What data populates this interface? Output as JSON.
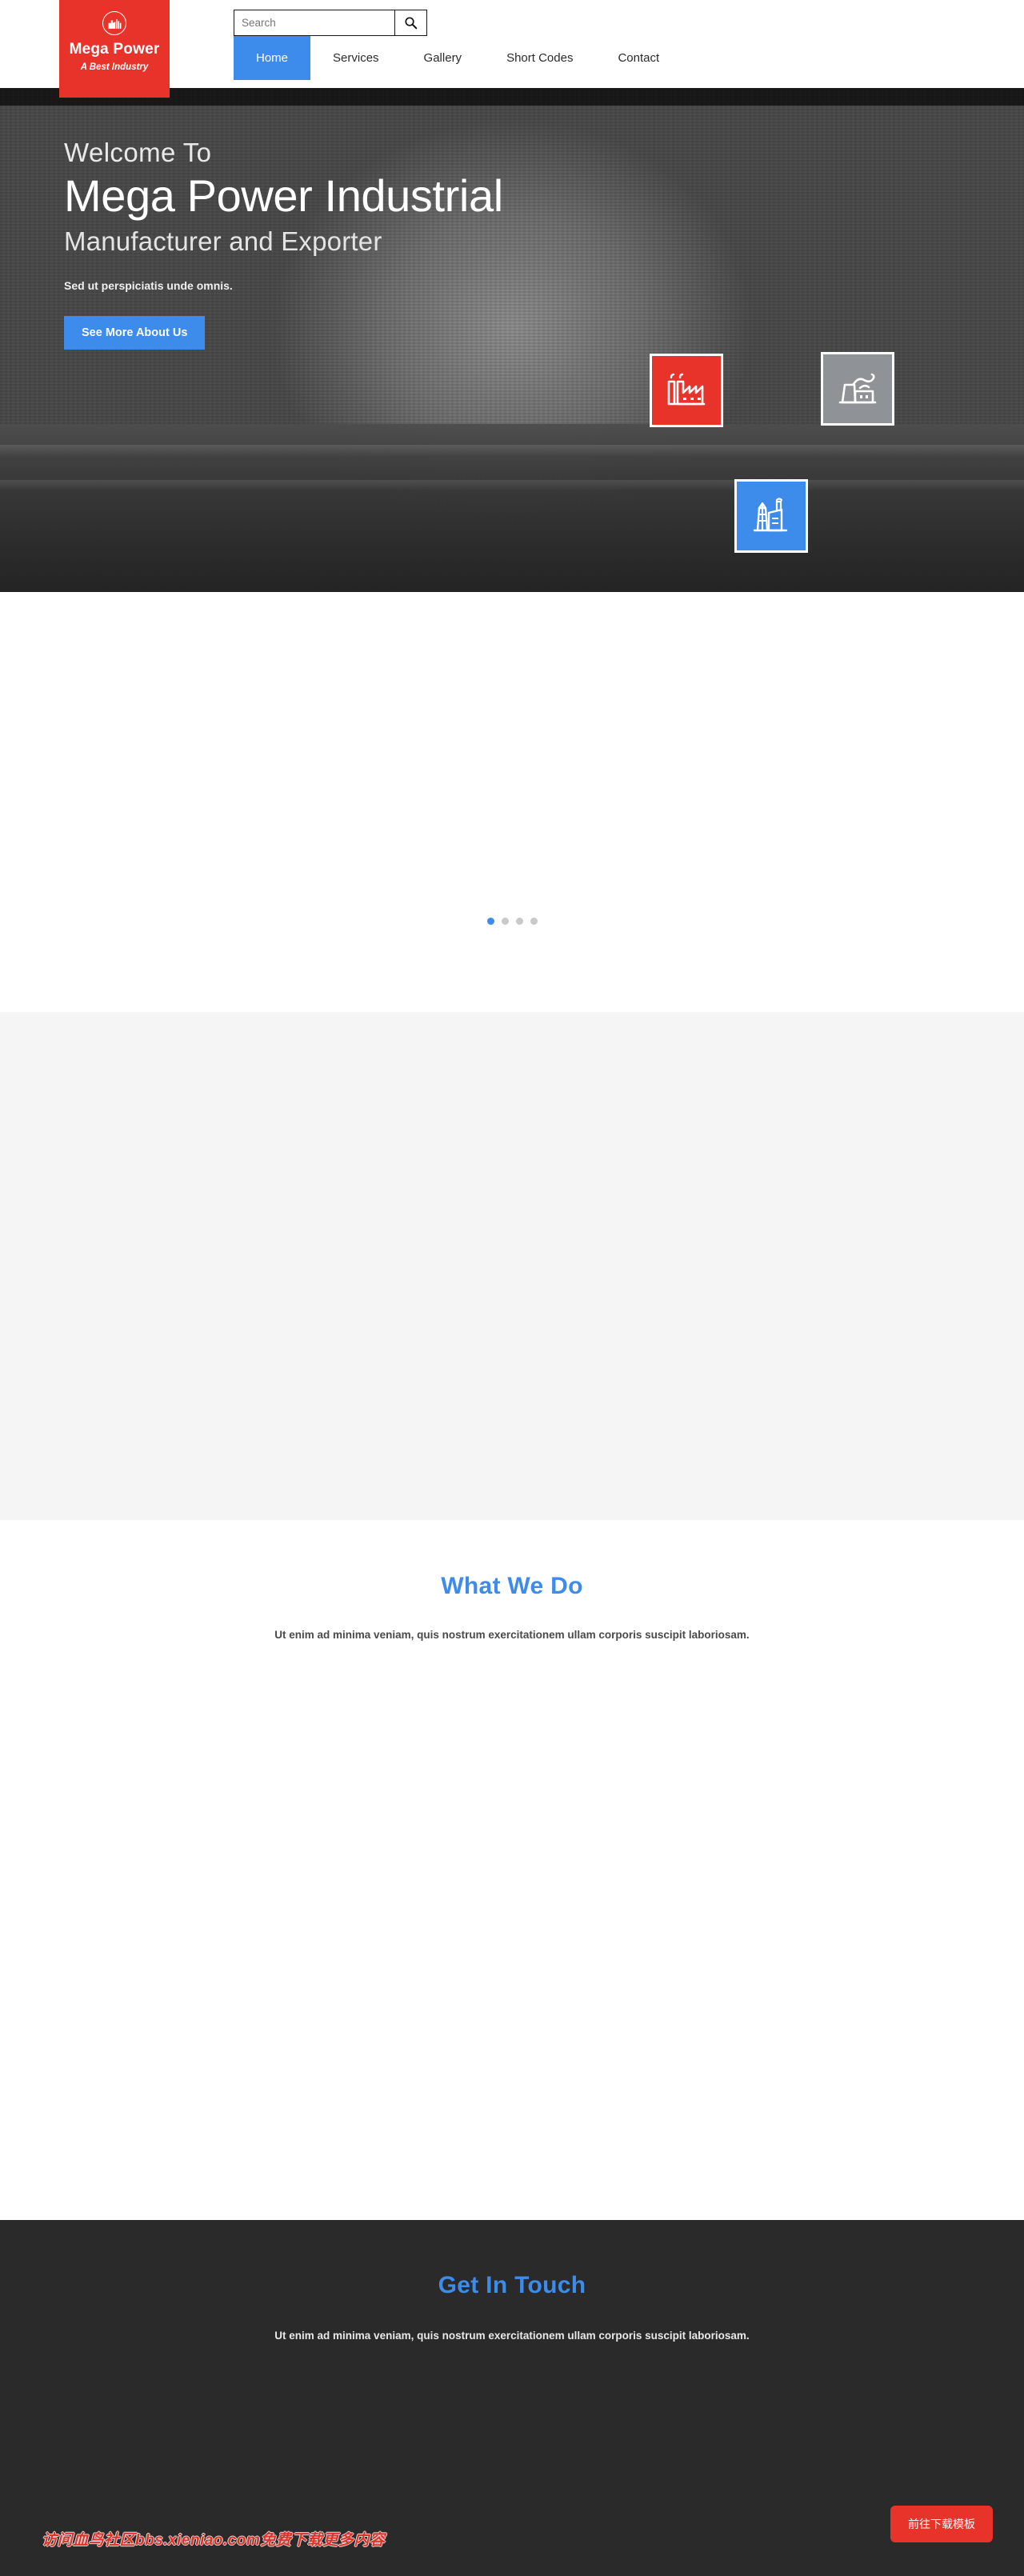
{
  "header": {
    "logo": {
      "icon": "factory-circle-icon",
      "title": "Mega Power",
      "tagline": "A Best Industry",
      "bg_color": "#e8332a"
    },
    "search": {
      "placeholder": "Search",
      "value": "",
      "button_icon": "search-icon"
    },
    "nav": [
      {
        "label": "Home",
        "active": true
      },
      {
        "label": "Services",
        "active": false
      },
      {
        "label": "Gallery",
        "active": false
      },
      {
        "label": "Short Codes",
        "active": false
      },
      {
        "label": "Contact",
        "active": false
      }
    ],
    "accent_color": "#3d8bea"
  },
  "hero": {
    "welcome": "Welcome To",
    "title": "Mega Power Industrial",
    "subtitle": "Manufacturer and Exporter",
    "description": "Sed ut perspiciatis unde omnis.",
    "button_label": "See More About Us",
    "icon_boxes": [
      {
        "icon": "factory-chimneys-icon",
        "color": "#e8332a"
      },
      {
        "icon": "factory-smoke-icon",
        "color": "#8f9296"
      },
      {
        "icon": "refinery-tower-icon",
        "color": "#3d8bea"
      }
    ]
  },
  "slider": {
    "dots": [
      {
        "active": true
      },
      {
        "active": false
      },
      {
        "active": false
      },
      {
        "active": false
      }
    ]
  },
  "sections": {
    "what_we_do": {
      "title": "What We Do",
      "lead": "Ut enim ad minima veniam, quis nostrum exercitationem ullam corporis suscipit laboriosam."
    },
    "get_in_touch": {
      "title": "Get In Touch",
      "lead": "Ut enim ad minima veniam, quis nostrum exercitationem ullam corporis suscipit laboriosam."
    }
  },
  "overlay": {
    "watermark": "访问血鸟社区bbs.xieniao.com免费下载更多内容",
    "download_button": "前往下载模板"
  }
}
